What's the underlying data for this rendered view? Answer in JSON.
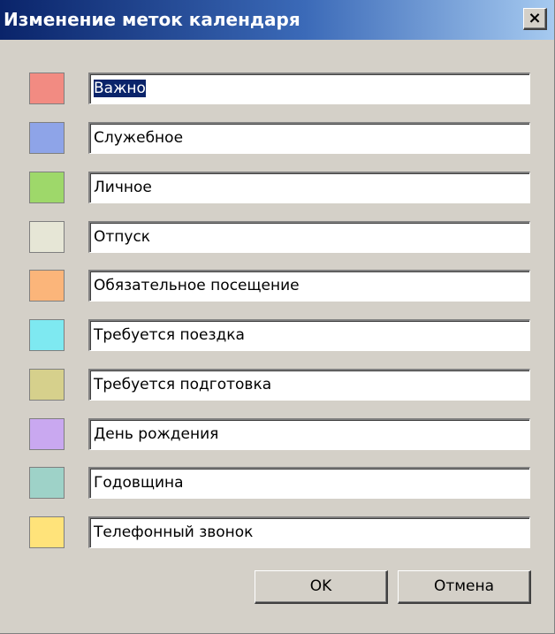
{
  "window": {
    "title": "Изменение меток календаря",
    "close_glyph": "×"
  },
  "labels": [
    {
      "color": "#f28b82",
      "text": "Важно"
    },
    {
      "color": "#8ea4e8",
      "text": "Служебное"
    },
    {
      "color": "#9ed86a",
      "text": "Личное"
    },
    {
      "color": "#e6e6d6",
      "text": "Отпуск"
    },
    {
      "color": "#fbb57a",
      "text": "Обязательное посещение"
    },
    {
      "color": "#7ee9f1",
      "text": "Требуется поездка"
    },
    {
      "color": "#d6d08c",
      "text": "Требуется подготовка"
    },
    {
      "color": "#c9a8f0",
      "text": "День рождения"
    },
    {
      "color": "#9ed2c8",
      "text": "Годовщина"
    },
    {
      "color": "#ffe37a",
      "text": "Телефонный звонок"
    }
  ],
  "buttons": {
    "ok_label": "OK",
    "cancel_label": "Отмена"
  }
}
